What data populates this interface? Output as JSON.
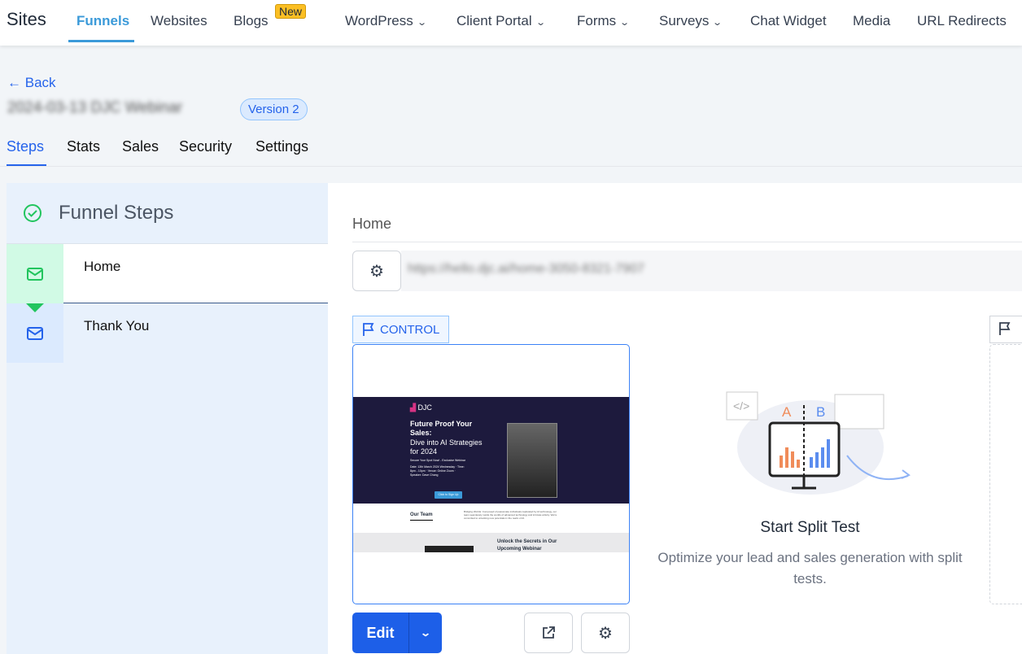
{
  "topnav": {
    "brand": "Sites",
    "items": [
      {
        "label": "Funnels",
        "active": true
      },
      {
        "label": "Websites"
      },
      {
        "label": "Blogs",
        "badge": "New"
      },
      {
        "label": "WordPress",
        "dropdown": true
      },
      {
        "label": "Client Portal",
        "dropdown": true
      },
      {
        "label": "Forms",
        "dropdown": true
      },
      {
        "label": "Surveys",
        "dropdown": true
      },
      {
        "label": "Chat Widget"
      },
      {
        "label": "Media"
      },
      {
        "label": "URL Redirects"
      }
    ]
  },
  "header": {
    "back": "Back",
    "title": "2024-03-13 DJC Webinar",
    "version": "Version 2"
  },
  "tabs": [
    "Steps",
    "Stats",
    "Sales",
    "Security",
    "Settings"
  ],
  "sidebar": {
    "title": "Funnel Steps",
    "steps": [
      {
        "label": "Home",
        "active": true
      },
      {
        "label": "Thank You"
      }
    ]
  },
  "main": {
    "step_title": "Home",
    "url": "https://hello.djc.ai/home-3050-8321-7907",
    "control_label": "CONTROL",
    "edit_label": "Edit",
    "preview": {
      "logo": "DJC",
      "headline1": "Future Proof Your Sales:",
      "headline2": "Dive into AI Strategies for 2024",
      "sub": "Secure Your Spot Now! - Exclusive Webinar",
      "details": "Date: 13th March 2024 Wednesday · Time: 8pm - 10pm · Venue: Online Zoom · Speaker: Dave Chong",
      "cta": "Click to Sign Up",
      "team_heading": "Our Team",
      "team_text": "Bridging Worlds: Composed of passionate individuals captivated by AI technology, our team seamlessly melds the worlds of advanced technology and intricate artistry. We're committed to unlocking new potentials in the realm of AI.",
      "unlock": "Unlock the Secrets in Our Upcoming Webinar"
    },
    "split": {
      "title": "Start Split Test",
      "description": "Optimize your lead and sales generation with split tests.",
      "a": "A",
      "b": "B"
    }
  },
  "colors": {
    "accent": "#2563eb",
    "funnels": "#3b9ad9",
    "badge": "#fbbf24",
    "success": "#22c55e"
  }
}
